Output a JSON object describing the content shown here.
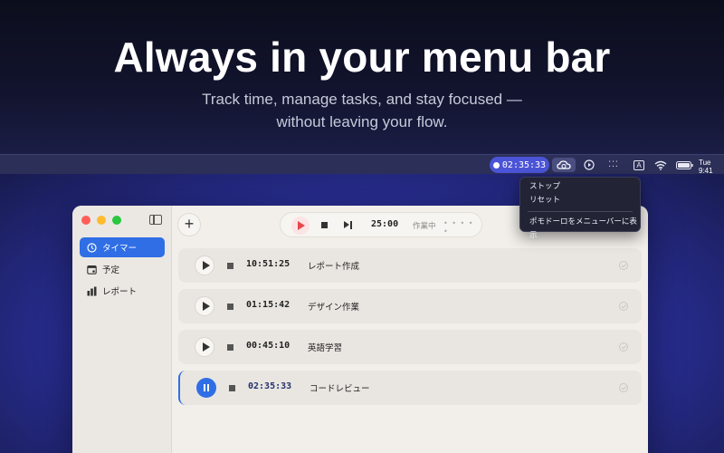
{
  "hero": {
    "title": "Always in your menu bar",
    "subtitle_line1": "Track time, manage tasks, and stay focused —",
    "subtitle_line2": "without leaving your flow."
  },
  "menubar": {
    "timer": "02:35:33",
    "clock": "Tue 9:41",
    "icons": [
      "timer-cloud-icon",
      "play-circle-icon",
      "dots-icon",
      "input-source-icon",
      "wifi-icon",
      "battery-icon"
    ]
  },
  "dropdown": {
    "items": [
      "ストップ",
      "リセット"
    ],
    "toggle_item": "ポモドーロをメニューバーに表示"
  },
  "sidebar": {
    "items": [
      {
        "label": "タイマー",
        "icon": "timer-icon",
        "active": true
      },
      {
        "label": "予定",
        "icon": "calendar-icon",
        "active": false
      },
      {
        "label": "レポート",
        "icon": "chart-icon",
        "active": false
      }
    ]
  },
  "player": {
    "time": "25:00",
    "status": "作業中",
    "dots": "• • • • •"
  },
  "tasks": [
    {
      "time": "10:51:25",
      "title": "レポート作成",
      "running": false
    },
    {
      "time": "01:15:42",
      "title": "デザイン作業",
      "running": false
    },
    {
      "time": "00:45:10",
      "title": "英語学習",
      "running": false
    },
    {
      "time": "02:35:33",
      "title": "コードレビュー",
      "running": true
    }
  ],
  "colors": {
    "accent": "#2f6ee5",
    "play_red": "#e5484d",
    "menubar_timer": "#4b54d6"
  }
}
